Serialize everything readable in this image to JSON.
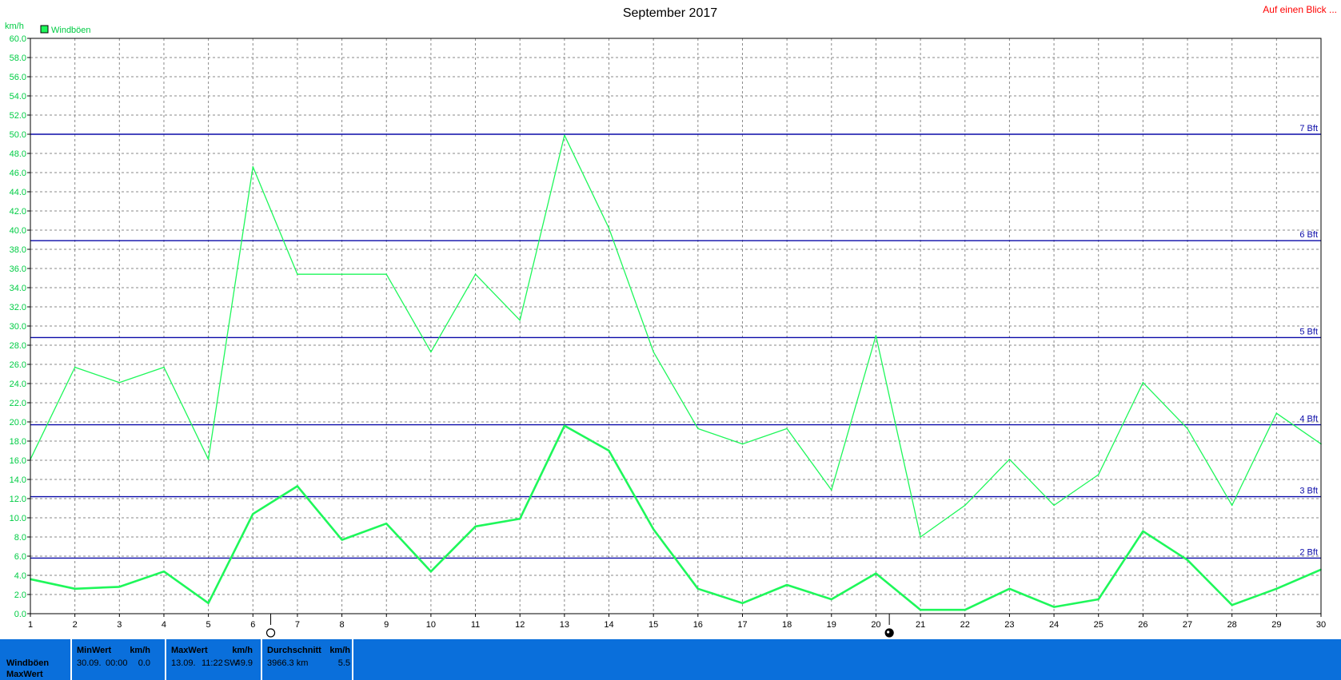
{
  "header": {
    "title": "September 2017",
    "link_label": "Auf einen Blick ..."
  },
  "colors": {
    "gust": "#1ef75a",
    "mean": "#1ef75a",
    "beaufort": "#0a0aa8",
    "grid": "#8a8a8a",
    "axis_text": "#00cc44",
    "link": "#ff0000",
    "panel": "#0a6fdb"
  },
  "moon_phases": [
    {
      "day": 6.4,
      "icon": "full-moon-icon"
    },
    {
      "day": 20.3,
      "icon": "new-moon-icon"
    }
  ],
  "chart_data": {
    "type": "line",
    "title": "September 2017",
    "unit_label": "km/h",
    "xlim": [
      1,
      30
    ],
    "ylim": [
      0,
      60
    ],
    "y_ticks": [
      "0.0",
      "2.0",
      "4.0",
      "6.0",
      "8.0",
      "10.0",
      "12.0",
      "14.0",
      "16.0",
      "18.0",
      "20.0",
      "22.0",
      "24.0",
      "26.0",
      "28.0",
      "30.0",
      "32.0",
      "34.0",
      "36.0",
      "38.0",
      "40.0",
      "42.0",
      "44.0",
      "46.0",
      "48.0",
      "50.0",
      "52.0",
      "54.0",
      "56.0",
      "58.0",
      "60.0"
    ],
    "x_ticks": [
      "1",
      "2",
      "3",
      "4",
      "5",
      "6",
      "7",
      "8",
      "9",
      "10",
      "11",
      "12",
      "13",
      "14",
      "15",
      "16",
      "17",
      "18",
      "19",
      "20",
      "21",
      "22",
      "23",
      "24",
      "25",
      "26",
      "27",
      "28",
      "29",
      "30"
    ],
    "grid": true,
    "legend": {
      "position": "top-left",
      "label": "Windböen"
    },
    "series": [
      {
        "name": "Windböen",
        "style": "thin",
        "x": [
          1,
          2,
          3,
          4,
          5,
          6,
          7,
          8,
          9,
          10,
          11,
          12,
          13,
          14,
          15,
          16,
          17,
          18,
          19,
          20,
          21,
          22,
          23,
          24,
          25,
          26,
          27,
          28,
          29,
          30
        ],
        "values": [
          16.1,
          25.7,
          24.1,
          25.7,
          16.1,
          46.6,
          35.4,
          35.4,
          35.4,
          27.3,
          35.4,
          30.6,
          49.9,
          40.2,
          27.3,
          19.3,
          17.7,
          19.3,
          12.9,
          29.0,
          8.0,
          11.3,
          16.1,
          11.3,
          14.5,
          24.1,
          19.3,
          11.3,
          20.9,
          17.7
        ]
      },
      {
        "name": "",
        "style": "thick",
        "x": [
          1,
          2,
          3,
          4,
          5,
          6,
          7,
          8,
          9,
          10,
          11,
          12,
          13,
          14,
          15,
          16,
          17,
          18,
          19,
          20,
          21,
          22,
          23,
          24,
          25,
          26,
          27,
          28,
          29,
          30
        ],
        "values": [
          3.6,
          2.6,
          2.8,
          4.4,
          1.1,
          10.4,
          13.3,
          7.7,
          9.4,
          4.4,
          9.1,
          9.9,
          19.6,
          17.0,
          8.8,
          2.6,
          1.1,
          3.0,
          1.5,
          4.2,
          0.4,
          0.4,
          2.6,
          0.7,
          1.5,
          8.6,
          5.6,
          0.9,
          2.6,
          4.6
        ]
      }
    ],
    "reference_lines": [
      {
        "label": "2 Bft",
        "value": 5.8
      },
      {
        "label": "3 Bft",
        "value": 12.2
      },
      {
        "label": "4 Bft",
        "value": 19.7
      },
      {
        "label": "5 Bft",
        "value": 28.8
      },
      {
        "label": "6 Bft",
        "value": 38.9
      },
      {
        "label": "7 Bft",
        "value": 50.0
      }
    ]
  },
  "summary": {
    "row1_label": "Windböen",
    "row2_label": "MaxWert",
    "min": {
      "header": "MinWert",
      "unit": "km/h",
      "date": "30.09.",
      "time": "00:00",
      "value": "0.0"
    },
    "max": {
      "header": "MaxWert",
      "unit": "km/h",
      "date": "13.09.",
      "time": "11:22",
      "dir": "SW",
      "value": "49.9"
    },
    "avg": {
      "header": "Durchschnitt",
      "unit": "km/h",
      "distance": "3966.3 km",
      "value": "5.5"
    }
  }
}
